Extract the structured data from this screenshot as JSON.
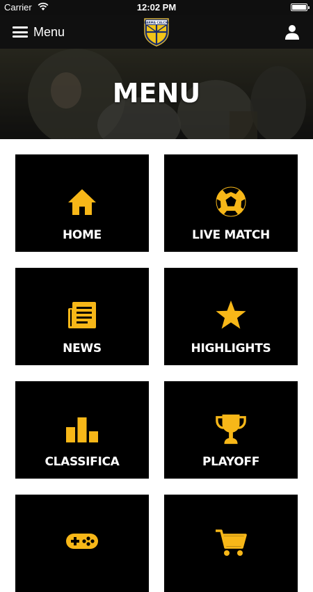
{
  "status_bar": {
    "carrier": "Carrier",
    "time": "12:02 PM"
  },
  "navbar": {
    "menu_label": "Menu",
    "crest_icon": "parma-calcio-crest",
    "user_icon": "user-icon"
  },
  "hero": {
    "title": "MENU"
  },
  "colors": {
    "accent": "#F7B718",
    "tile_bg": "#000000",
    "nav_bg": "#101010"
  },
  "tiles": [
    {
      "label": "HOME",
      "icon": "home-icon"
    },
    {
      "label": "LIVE MATCH",
      "icon": "soccer-ball-icon"
    },
    {
      "label": "NEWS",
      "icon": "newspaper-icon"
    },
    {
      "label": "HIGHLIGHTS",
      "icon": "star-icon"
    },
    {
      "label": "CLASSIFICA",
      "icon": "podium-icon"
    },
    {
      "label": "PLAYOFF",
      "icon": "trophy-icon"
    },
    {
      "label": "",
      "icon": "gamepad-icon"
    },
    {
      "label": "",
      "icon": "shopping-cart-icon"
    }
  ]
}
